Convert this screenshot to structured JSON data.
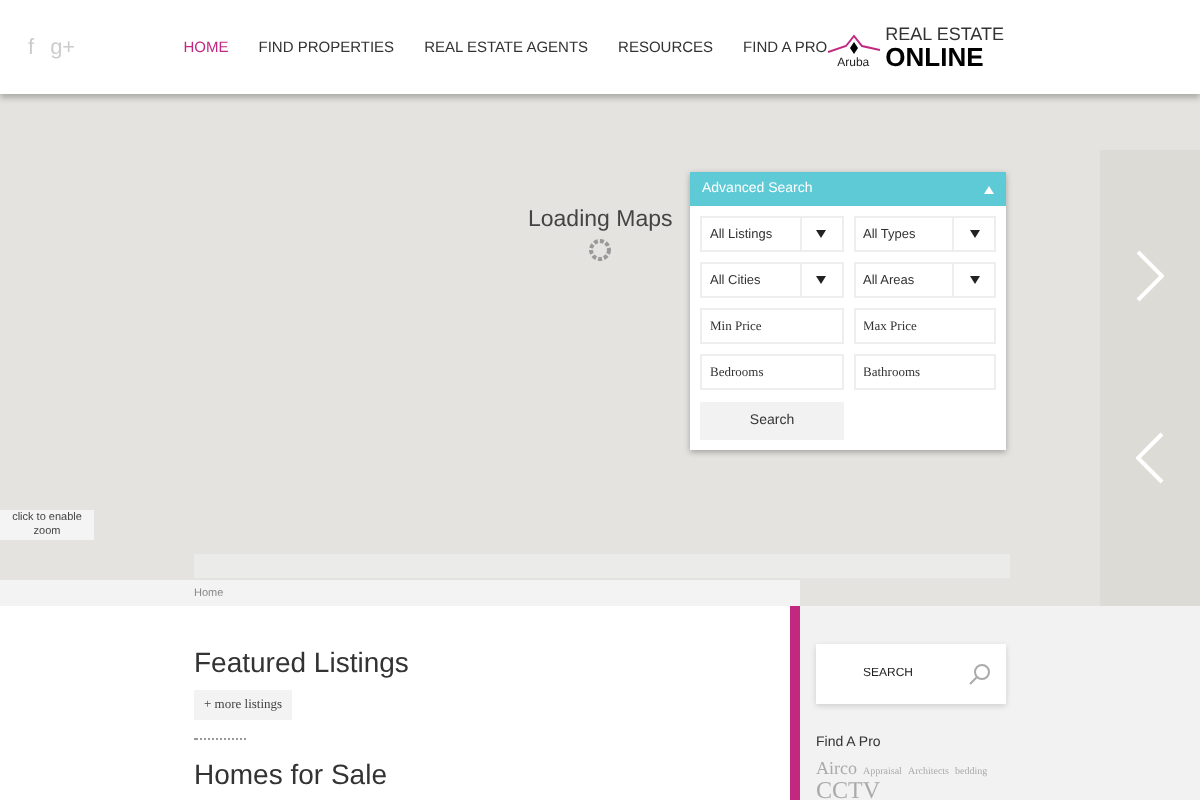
{
  "header": {
    "social": [
      "f",
      "g+"
    ],
    "nav": [
      {
        "label": "HOME",
        "selected": true
      },
      {
        "label": "FIND PROPERTIES",
        "selected": false
      },
      {
        "label": "REAL ESTATE AGENTS",
        "selected": false
      },
      {
        "label": "RESOURCES",
        "selected": false
      },
      {
        "label": "FIND A PRO",
        "selected": false
      }
    ],
    "logo": {
      "small": "Aruba",
      "top": "REAL ESTATE",
      "bottom": "ONLINE"
    }
  },
  "map": {
    "loading": "Loading Maps",
    "zoom_button": "click to enable zoom",
    "advanced_search": {
      "title": "Advanced Search",
      "expanded": true,
      "fields": [
        {
          "kind": "select",
          "value": "All Listings"
        },
        {
          "kind": "select",
          "value": "All Types"
        },
        {
          "kind": "select",
          "value": "All Cities"
        },
        {
          "kind": "select",
          "value": "All Areas"
        },
        {
          "kind": "input",
          "placeholder": "Min Price"
        },
        {
          "kind": "input",
          "placeholder": "Max Price"
        },
        {
          "kind": "input",
          "placeholder": "Bedrooms"
        },
        {
          "kind": "input",
          "placeholder": "Bathrooms"
        }
      ],
      "button": "Search"
    }
  },
  "breadcrumb": "Home",
  "main": {
    "featured_title": "Featured Listings",
    "more_button": "+ more listings",
    "next_title": "Homes for Sale"
  },
  "sidebar": {
    "search_placeholder": "SEARCH",
    "find_title": "Find A Pro",
    "tags": [
      {
        "label": "Airco",
        "kind": "large"
      },
      {
        "label": "Appraisal",
        "kind": "small"
      },
      {
        "label": "Architects",
        "kind": "small"
      },
      {
        "label": "bedding",
        "kind": "small"
      },
      {
        "label": "CCTV",
        "kind": "huge"
      }
    ]
  }
}
